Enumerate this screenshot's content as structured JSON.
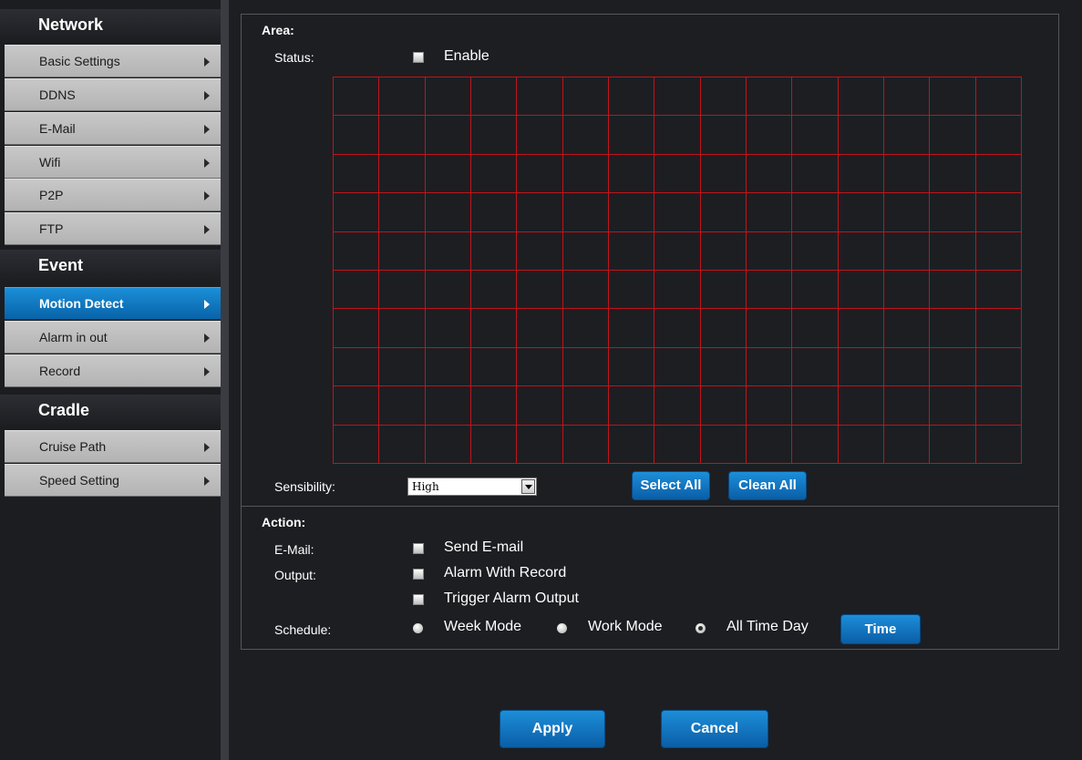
{
  "sidebar": {
    "sections": [
      {
        "title": "Network"
      },
      {
        "title": "Event"
      },
      {
        "title": "Cradle"
      }
    ],
    "items": [
      {
        "label": "Basic Settings"
      },
      {
        "label": "DDNS"
      },
      {
        "label": "E-Mail"
      },
      {
        "label": "Wifi"
      },
      {
        "label": "P2P"
      },
      {
        "label": "FTP"
      },
      {
        "label": "Motion Detect",
        "active": true
      },
      {
        "label": "Alarm in out"
      },
      {
        "label": "Record"
      },
      {
        "label": "Cruise Path"
      },
      {
        "label": "Speed Setting"
      }
    ]
  },
  "area": {
    "heading": "Area:",
    "status_label": "Status:",
    "enable_label": "Enable",
    "grid": {
      "columns": 15,
      "rows": 10
    },
    "sensibility_label": "Sensibility:",
    "sensibility_value": "High",
    "select_all": "Select All",
    "clean_all": "Clean All"
  },
  "action": {
    "heading": "Action:",
    "email_label": "E-Mail:",
    "send_email": "Send E-mail",
    "output_label": "Output:",
    "alarm_with_record": "Alarm With Record",
    "trigger_alarm_output": "Trigger Alarm Output",
    "schedule_label": "Schedule:",
    "week_mode": "Week Mode",
    "work_mode": "Work Mode",
    "all_time_day": "All Time Day",
    "schedule_selected": "All Time Day",
    "time_button": "Time"
  },
  "footer": {
    "apply": "Apply",
    "cancel": "Cancel"
  },
  "colors": {
    "accent": "#0a70bb",
    "grid_line": "#c0141b",
    "background": "#1d1e22"
  }
}
